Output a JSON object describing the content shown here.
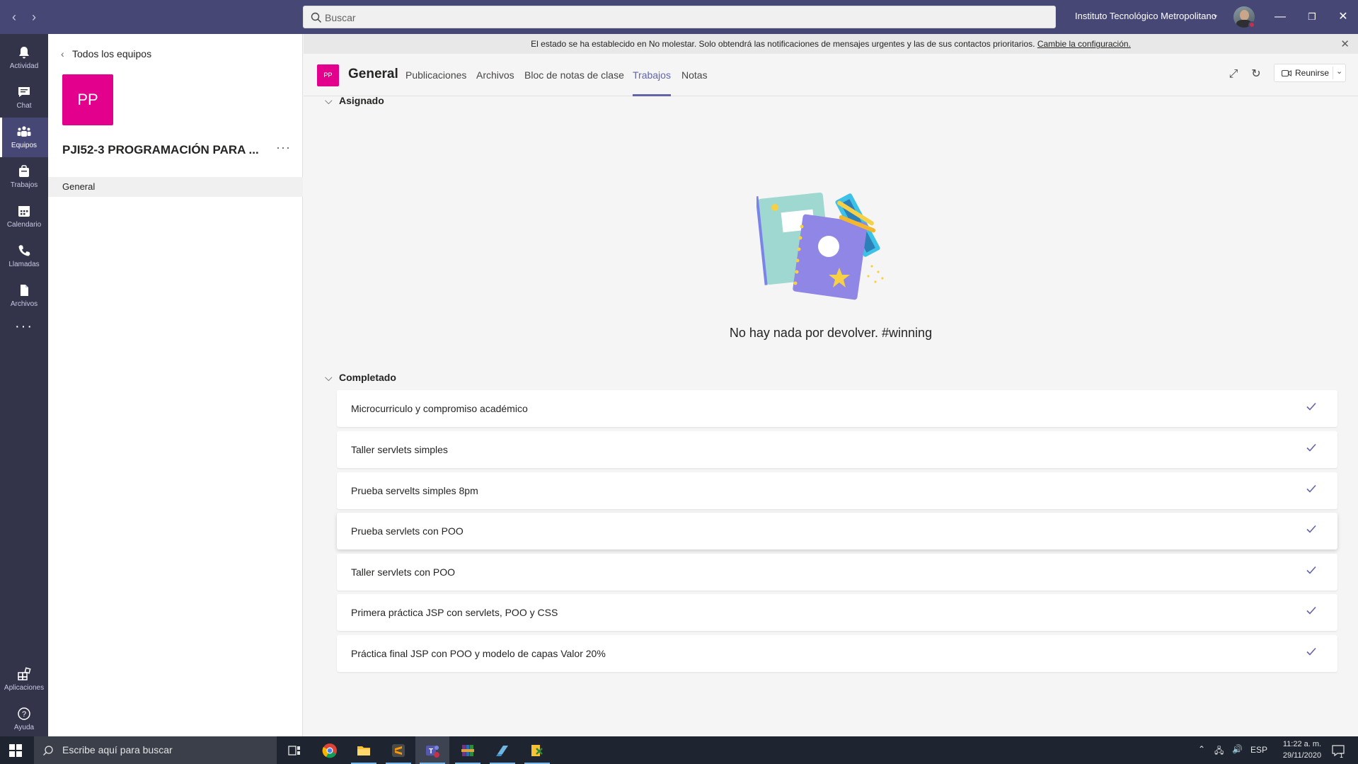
{
  "titlebar": {
    "search_placeholder": "Buscar",
    "org_name": "Instituto Tecnológico Metropolitano",
    "presence_color": "#c4314b",
    "brand_color": "#464775"
  },
  "rail": [
    {
      "label": "Actividad",
      "icon": "bell-icon"
    },
    {
      "label": "Chat",
      "icon": "chat-icon"
    },
    {
      "label": "Equipos",
      "icon": "teams-icon",
      "active": true
    },
    {
      "label": "Trabajos",
      "icon": "assignments-icon"
    },
    {
      "label": "Calendario",
      "icon": "calendar-icon"
    },
    {
      "label": "Llamadas",
      "icon": "phone-icon"
    },
    {
      "label": "Archivos",
      "icon": "file-icon"
    },
    {
      "label": "Aplicaciones",
      "icon": "apps-icon"
    },
    {
      "label": "Ayuda",
      "icon": "help-icon"
    }
  ],
  "teampanel": {
    "back_label": "Todos los equipos",
    "team_initials": "PP",
    "team_name": "PJI52-3 PROGRAMACIÓN PARA ...",
    "team_color": "#e3008c",
    "channels": [
      "General"
    ]
  },
  "banner": {
    "text": "El estado se ha establecido en No molestar. Solo obtendrá las notificaciones de mensajes urgentes y las de sus contactos prioritarios.",
    "link": "Cambie la configuración."
  },
  "header": {
    "channel_initials": "PP",
    "channel_name": "General",
    "tabs": [
      "Publicaciones",
      "Archivos",
      "Bloc de notas de clase",
      "Trabajos",
      "Notas"
    ],
    "active_tab": "Trabajos",
    "meet_label": "Reunirse",
    "accent_color": "#6264a7"
  },
  "assigned": {
    "heading": "Asignado",
    "empty_message": "No hay nada por devolver. #winning"
  },
  "completed": {
    "heading": "Completado",
    "items": [
      "Microcurriculo y compromiso académico",
      "Taller servlets simples",
      "Prueba servelts simples 8pm",
      "Prueba servlets con POO",
      "Taller servlets con POO",
      "Primera práctica JSP con servlets, POO y CSS",
      "Práctica final JSP con POO y modelo de capas Valor 20%"
    ]
  },
  "taskbar": {
    "search_placeholder": "Escribe aquí para buscar",
    "language": "ESP",
    "time": "11:22 a. m.",
    "date": "29/11/2020",
    "notifications_count": "1"
  }
}
